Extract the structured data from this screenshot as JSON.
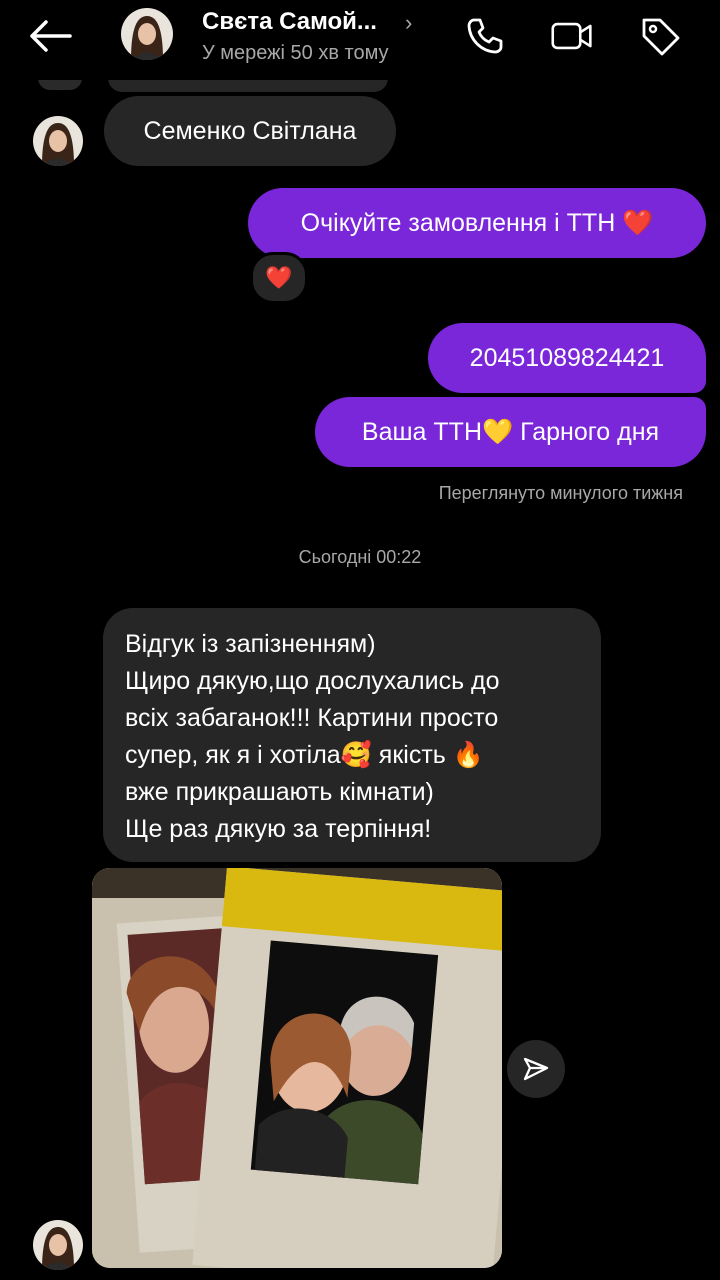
{
  "header": {
    "contact_name": "Свєта Самой...",
    "status": "У мережі 50 хв тому",
    "icons": [
      "back-arrow-icon",
      "phone-icon",
      "video-camera-icon",
      "tag-icon"
    ]
  },
  "messages": {
    "name_msg": "Семенко Світлана",
    "out_1": "Очікуйте замовлення і ТТН ❤️",
    "out_1_reaction": "❤️",
    "out_2": "20451089824421",
    "out_3": "Ваша ТТН💛 Гарного дня",
    "seen": "Переглянуто минулого тижня",
    "date_sep": "Сьогодні 00:22",
    "review_lines": [
      "Відгук із запізненням)",
      "Щиро дякую,що дослухались до",
      "всіх забаганок!!! Картини просто",
      "супер, як я і хотіла🥰 якість 🔥",
      "вже прикрашають кімнати)",
      "Ще раз дякую за терпіння!"
    ]
  },
  "colors": {
    "background": "#000000",
    "incoming_bubble": "#262626",
    "outgoing_bubble": "#7a26d9",
    "secondary_text": "#a8a8a8"
  }
}
